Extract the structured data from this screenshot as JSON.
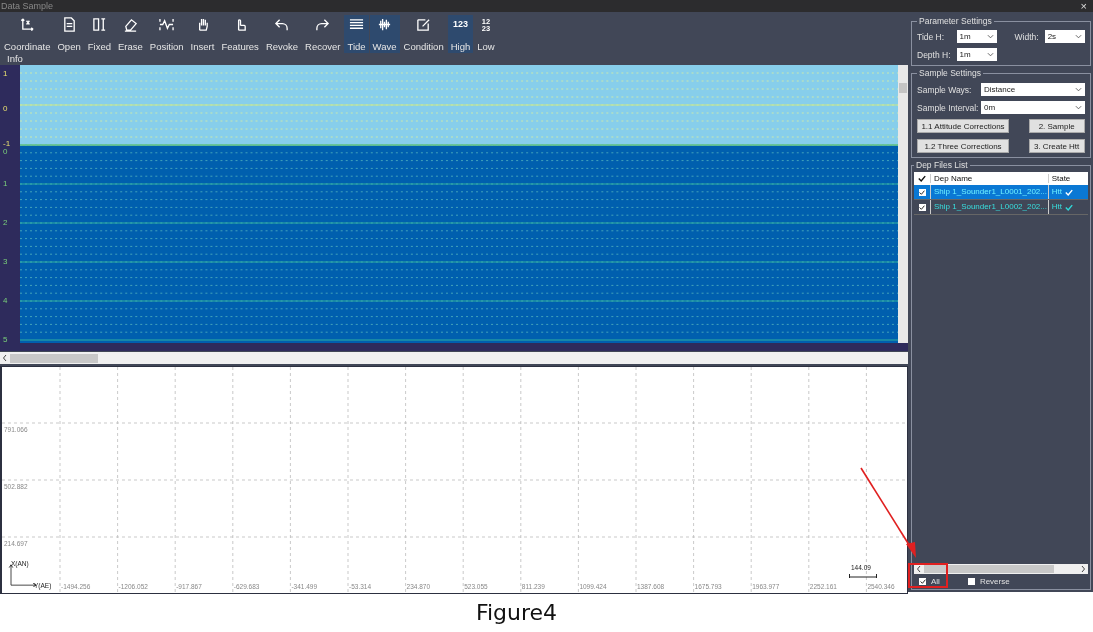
{
  "window": {
    "title": "Data Sample",
    "close": "×"
  },
  "toolbar": [
    {
      "label": "Coordinate",
      "selected": false
    },
    {
      "label": "Open",
      "selected": false
    },
    {
      "label": "Fixed",
      "selected": false
    },
    {
      "label": "Erase",
      "selected": false
    },
    {
      "label": "Position",
      "selected": false
    },
    {
      "label": "Insert",
      "selected": false
    },
    {
      "label": "Features",
      "selected": false
    },
    {
      "label": "Revoke",
      "selected": false
    },
    {
      "label": "Recover",
      "selected": false
    },
    {
      "label": "Tide",
      "selected": true
    },
    {
      "label": "Wave",
      "selected": true
    },
    {
      "label": "Condition",
      "selected": false
    },
    {
      "label": "High",
      "selected": true,
      "icon_text": [
        "123"
      ]
    },
    {
      "label": "Low",
      "selected": false,
      "icon_text": [
        "12",
        "23"
      ]
    }
  ],
  "info_label": "Info",
  "profile": {
    "tide_scale": [
      "1",
      "0",
      "-1"
    ],
    "depth_scale": [
      "0",
      "1",
      "2",
      "3",
      "4",
      "5"
    ]
  },
  "plan_view": {
    "y_ticks": [
      "791.066",
      "502.882",
      "214.697"
    ],
    "x_ticks": [
      "-1494.256",
      "-1206.052",
      "-917.867",
      "-629.683",
      "-341.499",
      "-53.314",
      "234.870",
      "523.055",
      "811.239",
      "1099.424",
      "1387.608",
      "1675.793",
      "1963.977",
      "2252.161",
      "2540.346"
    ],
    "x_axis_label": "X(AN)",
    "y_axis_label": "Y(AE)",
    "scale_bar": "144.09"
  },
  "parameter_settings": {
    "title": "Parameter Settings",
    "fields": [
      {
        "label": "Tide H:",
        "value": "1m"
      },
      {
        "label": "Width:",
        "value": "2s"
      },
      {
        "label": "Depth H:",
        "value": "1m"
      }
    ]
  },
  "sample_settings": {
    "title": "Sample Settings",
    "fields": [
      {
        "label": "Sample Ways:",
        "value": "Distance"
      },
      {
        "label": "Sample Interval:",
        "value": "0m"
      }
    ],
    "buttons": [
      "1.1 Attitude Corrections",
      "2. Sample",
      "1.2 Three Corrections",
      "3. Create Htt"
    ]
  },
  "dep_files": {
    "title": "Dep Files List",
    "header_checked": true,
    "columns": [
      "Dep Name",
      "State"
    ],
    "rows": [
      {
        "checked": true,
        "name": "Ship 1_Sounder1_L0001_202...",
        "state": "Htt",
        "selected": true
      },
      {
        "checked": true,
        "name": "Ship 1_Sounder1_L0002_202...",
        "state": "Htt",
        "selected": false
      }
    ],
    "options": [
      {
        "label": "All",
        "checked": true
      },
      {
        "label": "Reverse",
        "checked": false
      }
    ]
  },
  "caption": "Figure4"
}
